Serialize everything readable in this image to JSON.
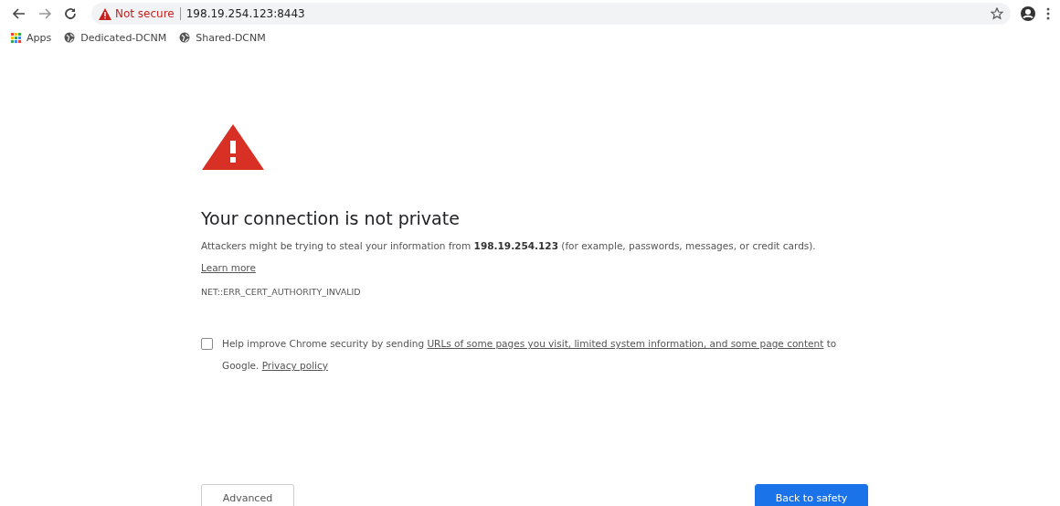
{
  "browser": {
    "security_label": "Not secure",
    "address": "198.19.254.123:8443"
  },
  "bookmarks": [
    {
      "kind": "apps",
      "label": "Apps"
    },
    {
      "kind": "site",
      "label": "Dedicated-DCNM"
    },
    {
      "kind": "site",
      "label": "Shared-DCNM"
    }
  ],
  "interstitial": {
    "heading": "Your connection is not private",
    "message": [
      {
        "kind": "text",
        "text": "Attackers might be trying to steal your information from **198.19.254.123** (for example, passwords, messages, or credit cards). "
      },
      {
        "kind": "link",
        "text": "Learn more"
      }
    ],
    "error_code": "NET::ERR_CERT_AUTHORITY_INVALID",
    "report_option": {
      "checked": false,
      "text": [
        {
          "kind": "text",
          "text": "Help improve Chrome security by sending "
        },
        {
          "kind": "link",
          "text": "URLs of some pages you visit, limited system information, and some page content"
        },
        {
          "kind": "text",
          "text": " to Google. "
        },
        {
          "kind": "link",
          "text": "Privacy policy"
        }
      ]
    },
    "buttons": [
      {
        "kind": "secondary",
        "label": "Advanced"
      },
      {
        "kind": "primary",
        "label": "Back to safety"
      }
    ]
  }
}
